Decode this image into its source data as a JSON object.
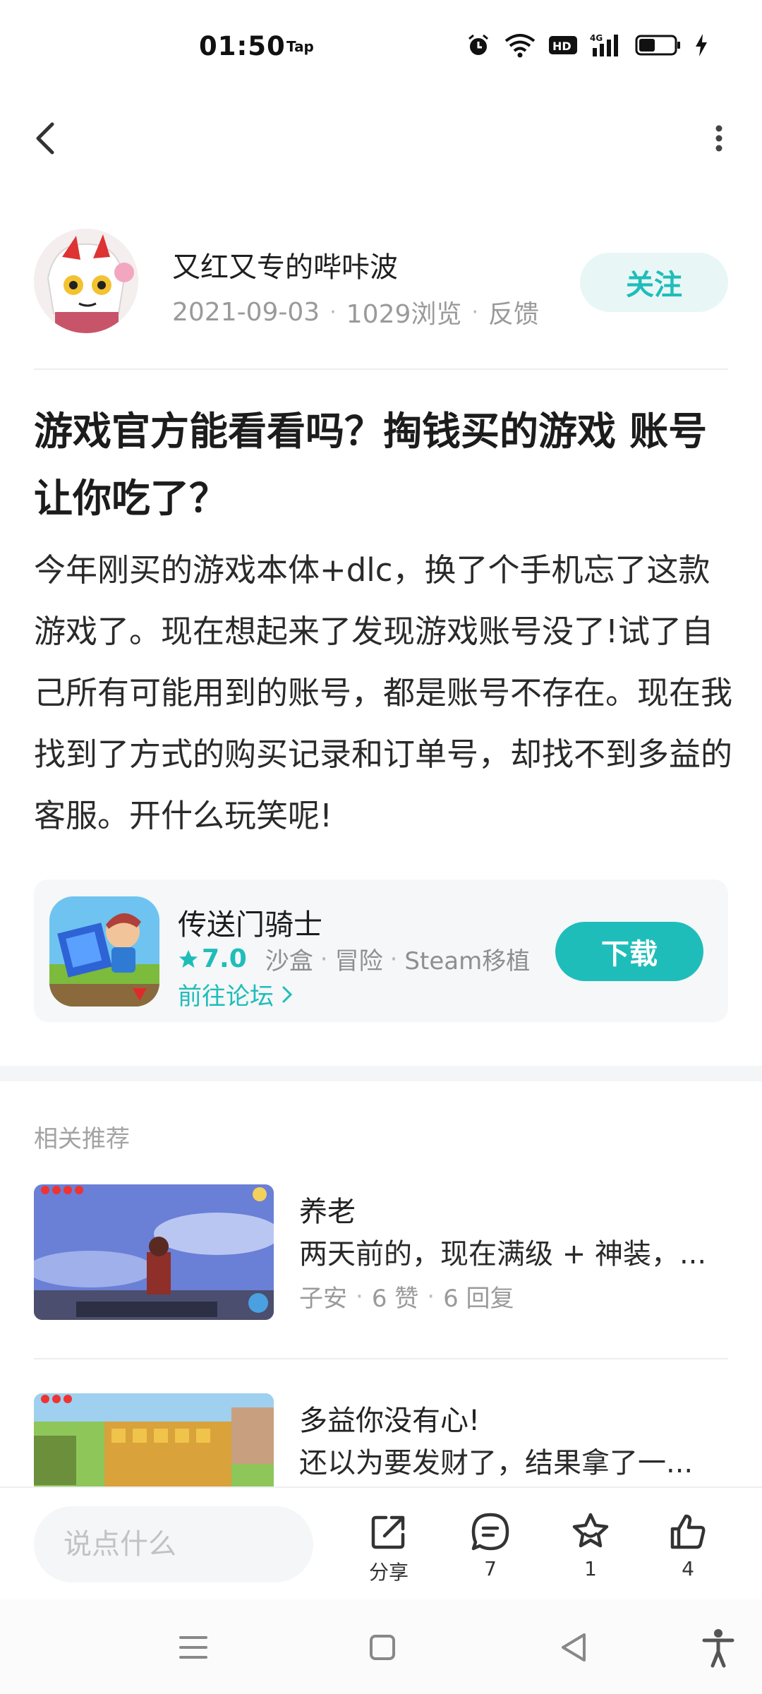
{
  "status_bar": {
    "time": "01:50",
    "tap_label": "Tap",
    "icons": [
      "alarm-icon",
      "wifi-icon",
      "hd-icon",
      "signal-4g-icon",
      "battery-icon",
      "charging-icon"
    ]
  },
  "nav": {
    "back_icon": "chevron-left-icon",
    "more_icon": "more-vertical-icon"
  },
  "author": {
    "name": "又红又专的哔咔波",
    "date": "2021-09-03",
    "views": "1029浏览",
    "feedback": "反馈",
    "follow_label": "关注"
  },
  "post": {
    "title": "游戏官方能看看吗？掏钱买的游戏 账号让你吃了？",
    "body": "今年刚买的游戏本体+dlc，换了个手机忘了这款游戏了。现在想起来了发现游戏账号没了!试了自己所有可能用到的账号，都是账号不存在。现在我找到了方式的购买记录和订单号，却找不到多益的客服。开什么玩笑呢!"
  },
  "app_card": {
    "name": "传送门骑士",
    "rating": "7.0",
    "tags": [
      "沙盒",
      "冒险",
      "Steam移植"
    ],
    "forum_link": "前往论坛",
    "download_label": "下载"
  },
  "recommendations": {
    "header": "相关推荐",
    "items": [
      {
        "title": "养老",
        "summary": "两天前的，现在满级 + 神装，...",
        "author": "子安",
        "likes": "6 赞",
        "replies": "6 回复"
      },
      {
        "title": "多益你没有心!",
        "summary": "还以为要发财了，结果拿了一..."
      }
    ]
  },
  "action_bar": {
    "comment_placeholder": "说点什么",
    "share_label": "分享",
    "comments_count": "7",
    "favorites_count": "1",
    "likes_count": "4"
  },
  "colors": {
    "accent": "#1fbdba",
    "accent_light": "#e8f7f6",
    "text_primary": "#222222",
    "text_secondary": "#9a9a9a"
  }
}
